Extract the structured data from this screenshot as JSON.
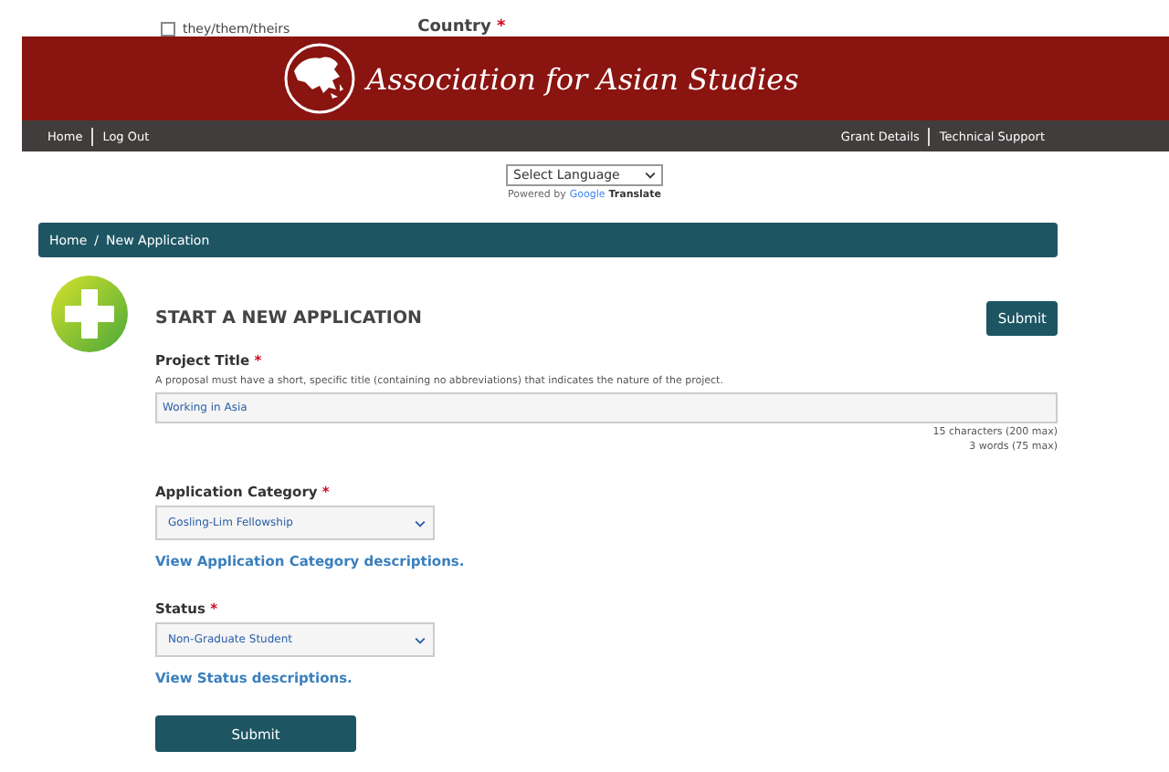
{
  "top_fragment": {
    "checkboxes": [
      {
        "label": "they/them/theirs",
        "checked": false
      }
    ],
    "country_label": "Country",
    "country_mark": "*"
  },
  "header": {
    "title": "Association for Asian Studies"
  },
  "nav": {
    "left": [
      "Home",
      "Log Out"
    ],
    "right": [
      "Grant Details",
      "Technical Support"
    ]
  },
  "translate": {
    "select": "Select Language",
    "powered_by": "Powered by",
    "google": "Google",
    "translate": "Translate"
  },
  "breadcrumb": [
    "Home",
    "New Application"
  ],
  "breadcrumb_separator": "/",
  "page": {
    "heading": "START A NEW APPLICATION",
    "submit_top": "Submit",
    "submit_bottom": "Submit"
  },
  "fields": [
    {
      "kind": "textarea",
      "label": "Project Title",
      "required_mark": "*",
      "help": "A proposal must have a short, specific title (containing no abbreviations) that indicates the nature of the project.",
      "value": "Working in Asia",
      "counts": [
        "15 characters (200 max)",
        "3 words (75 max)"
      ]
    },
    {
      "kind": "select",
      "label": "Application Category",
      "required_mark": "*",
      "value": "Gosling-Lim Fellowship",
      "link": "View Application Category descriptions."
    },
    {
      "kind": "select",
      "label": "Status",
      "required_mark": "*",
      "value": "Non-Graduate Student",
      "link": "View Status descriptions."
    }
  ]
}
